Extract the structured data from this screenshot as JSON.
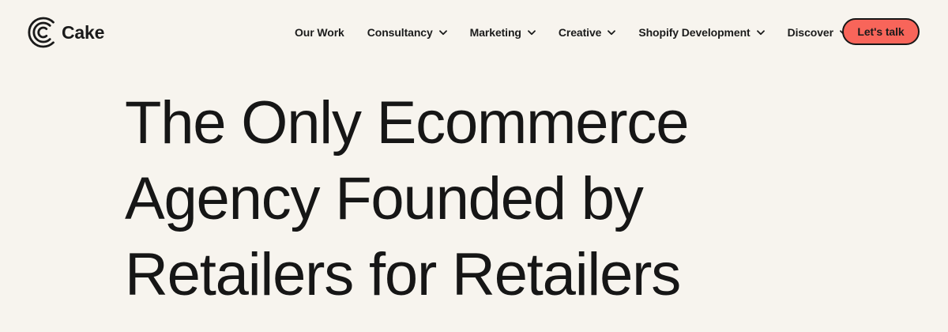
{
  "brand": {
    "name": "Cake",
    "logo_icon": "concentric-c-logo-icon"
  },
  "nav": {
    "items": [
      {
        "label": "Our Work",
        "has_dropdown": false
      },
      {
        "label": "Consultancy",
        "has_dropdown": true
      },
      {
        "label": "Marketing",
        "has_dropdown": true
      },
      {
        "label": "Creative",
        "has_dropdown": true
      },
      {
        "label": "Shopify Development",
        "has_dropdown": true
      },
      {
        "label": "Discover",
        "has_dropdown": true
      }
    ],
    "dropdown_icon": "chevron-down-icon"
  },
  "cta": {
    "label": "Let's talk",
    "color": "#f8655a"
  },
  "hero": {
    "lines": [
      "The Only Ecommerce",
      "Agency Founded by",
      "Retailers for Retailers"
    ]
  },
  "colors": {
    "background": "#f7f4ee",
    "text": "#1a1a1a",
    "accent": "#f8655a"
  }
}
